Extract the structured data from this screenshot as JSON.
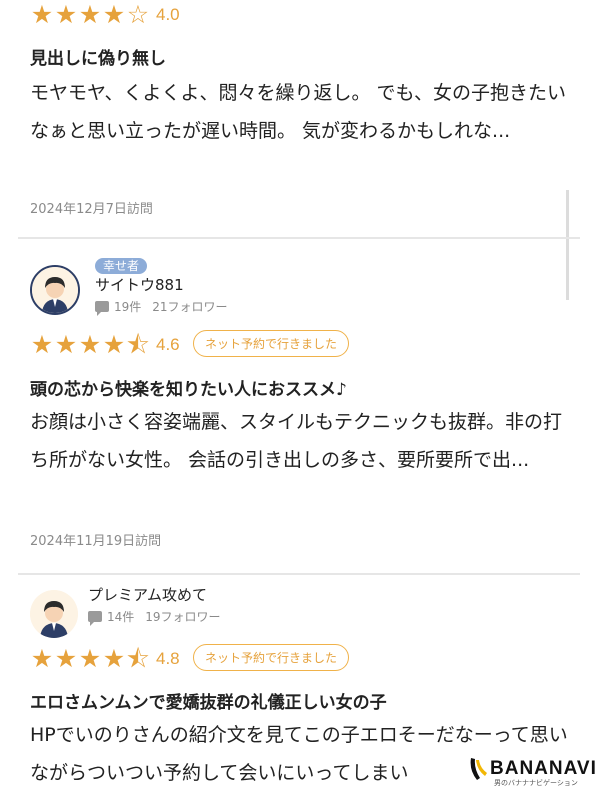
{
  "reviews": [
    {
      "rating": "4.0",
      "stars": 4,
      "title": "見出しに偽り無し",
      "body": "モヤモヤ、くよくよ、悶々を繰り返し。 でも、女の子抱きたいなぁと思い立ったが遅い時間。 気が変わるかもしれな...",
      "date": "2024年12月7日訪問"
    },
    {
      "role": "幸せ者",
      "user": "サイトウ881",
      "reviews_count": "19件",
      "followers": "21フォロワー",
      "rating": "4.6",
      "stars": 4.5,
      "badge": "ネット予約で行きました",
      "title": "頭の芯から快楽を知りたい人におススメ♪",
      "body": "お顔は小さく容姿端麗、スタイルもテクニックも抜群。非の打ち所がない女性。 会話の引き出しの多さ、要所要所で出...",
      "date": "2024年11月19日訪問"
    },
    {
      "user": "プレミアム攻めて",
      "reviews_count": "14件",
      "followers": "19フォロワー",
      "rating": "4.8",
      "stars": 4.5,
      "badge": "ネット予約で行きました",
      "title": "エロさムンムンで愛嬌抜群の礼儀正しい女の子",
      "body": "HPでいのりさんの紹介文を見てこの子エロそーだなーって思いながらついつい予約して会いにいってしまい"
    }
  ],
  "watermark": {
    "name": "BANANAVI",
    "tagline": "男のバナナナビゲーション"
  },
  "colors": {
    "star": "#e6a23c",
    "role_tag": "#8dacd8",
    "divider": "#e6e6e6"
  }
}
